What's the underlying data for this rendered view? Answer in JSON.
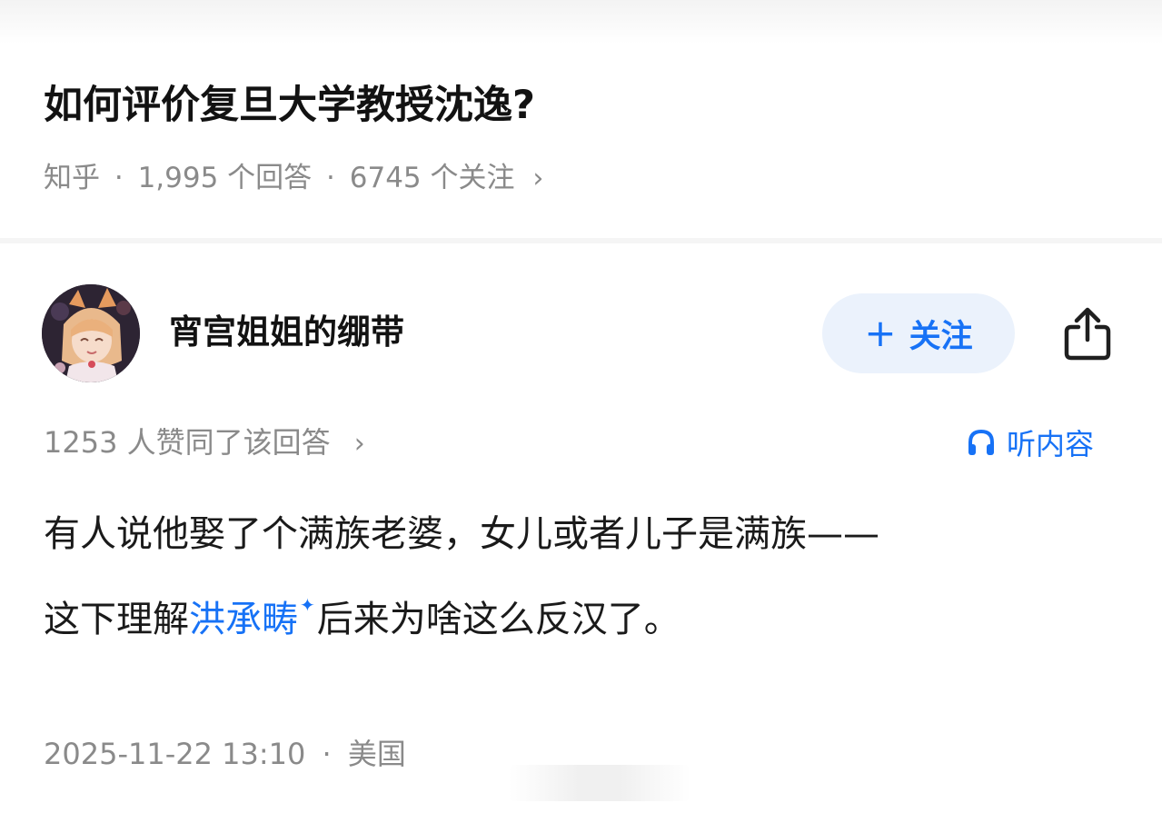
{
  "question": {
    "title": "如何评价复旦大学教授沈逸?",
    "source": "知乎",
    "answers_count": "1,995 个回答",
    "followers_count": "6745 个关注",
    "separator": "·",
    "chevron": "›"
  },
  "author": {
    "name": "宵宫姐姐的绷带",
    "avatar_icon": "anime-avatar",
    "follow_label": "关注",
    "follow_icon": "+",
    "share_icon": "share-icon"
  },
  "answer": {
    "votes": "1253 人赞同了该回答",
    "chevron": "›",
    "listen_label": "听内容",
    "listen_icon": "headphones-icon",
    "line1": "有人说他娶了个满族老婆，女儿或者儿子是满族——",
    "line2_prefix": "这下理解",
    "line2_link": "洪承畴",
    "line2_link_mark": "✦",
    "line2_suffix": "后来为啥这么反汉了。",
    "date": "2025-11-22 13:10",
    "separator": "·",
    "location": "美国"
  },
  "colors": {
    "accent": "#1772f6",
    "follow_bg": "#ebf2fc",
    "muted_text": "#8a8a8a",
    "title_text": "#121212"
  }
}
